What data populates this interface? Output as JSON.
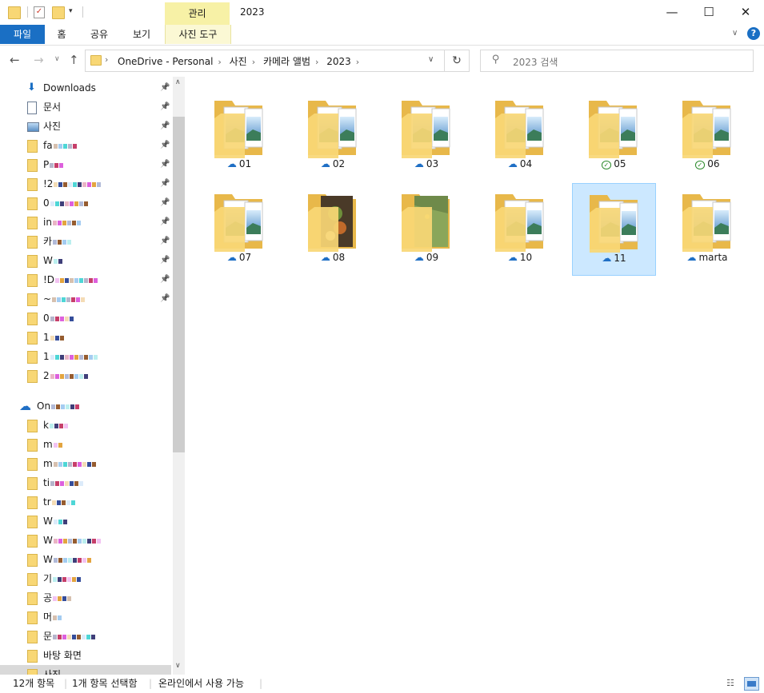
{
  "window": {
    "title": "2023",
    "contextual_group": "관리",
    "controls": {
      "minimize": "—",
      "maximize": "☐",
      "close": "✕"
    }
  },
  "ribbon": {
    "tabs": [
      "파일",
      "홈",
      "공유",
      "보기"
    ],
    "contextual_tab": "사진 도구"
  },
  "address": {
    "breadcrumbs": [
      "OneDrive - Personal",
      "사진",
      "카메라 앨범",
      "2023"
    ],
    "search_placeholder": "2023 검색"
  },
  "nav": {
    "items": [
      {
        "label": "Downloads",
        "icon": "download-icon",
        "pinned": true
      },
      {
        "label": "문서",
        "icon": "document-icon",
        "pinned": true
      },
      {
        "label": "사진",
        "icon": "picture-icon",
        "pinned": true
      },
      {
        "label": "fa",
        "icon": "folder-icon",
        "pinned": true
      },
      {
        "label": "P",
        "icon": "folder-icon",
        "pinned": true
      },
      {
        "label": "!2",
        "icon": "folder-icon",
        "pinned": true
      },
      {
        "label": "0",
        "icon": "folder-icon",
        "pinned": true
      },
      {
        "label": "in",
        "icon": "folder-icon",
        "pinned": true
      },
      {
        "label": "카",
        "icon": "folder-icon",
        "pinned": true
      },
      {
        "label": "W",
        "icon": "folder-icon",
        "pinned": true
      },
      {
        "label": "!D",
        "icon": "folder-icon",
        "pinned": true
      },
      {
        "label": "~",
        "icon": "folder-icon",
        "pinned": true
      },
      {
        "label": "0",
        "icon": "folder-icon",
        "pinned": false
      },
      {
        "label": "1",
        "icon": "folder-icon",
        "pinned": false
      },
      {
        "label": "1",
        "icon": "folder-icon",
        "pinned": false
      },
      {
        "label": "2",
        "icon": "folder-icon",
        "pinned": false
      },
      {
        "label": "On",
        "icon": "onedrive-cloud-icon",
        "pinned": false
      },
      {
        "label": "k",
        "icon": "folder-icon",
        "pinned": false
      },
      {
        "label": "m",
        "icon": "folder-icon",
        "pinned": false
      },
      {
        "label": "m",
        "icon": "folder-icon",
        "pinned": false
      },
      {
        "label": "ti",
        "icon": "folder-icon",
        "pinned": false
      },
      {
        "label": "tr",
        "icon": "folder-icon",
        "pinned": false
      },
      {
        "label": "W",
        "icon": "folder-icon",
        "pinned": false
      },
      {
        "label": "W",
        "icon": "folder-icon",
        "pinned": false
      },
      {
        "label": "W",
        "icon": "folder-icon",
        "pinned": false
      },
      {
        "label": "기",
        "icon": "folder-icon",
        "pinned": false
      },
      {
        "label": "공",
        "icon": "folder-icon",
        "pinned": false
      },
      {
        "label": "머",
        "icon": "folder-icon",
        "pinned": false
      },
      {
        "label": "문",
        "icon": "folder-icon",
        "pinned": false
      },
      {
        "label": "바탕 화면",
        "icon": "folder-icon",
        "pinned": false
      },
      {
        "label": "사진",
        "icon": "folder-icon",
        "pinned": false
      }
    ]
  },
  "files": [
    {
      "name": "01",
      "status": "cloud",
      "thumb": "landscape"
    },
    {
      "name": "02",
      "status": "cloud",
      "thumb": "landscape"
    },
    {
      "name": "03",
      "status": "cloud",
      "thumb": "landscape"
    },
    {
      "name": "04",
      "status": "cloud",
      "thumb": "landscape"
    },
    {
      "name": "05",
      "status": "synced",
      "thumb": "landscape"
    },
    {
      "name": "06",
      "status": "synced",
      "thumb": "landscape"
    },
    {
      "name": "07",
      "status": "cloud",
      "thumb": "landscape"
    },
    {
      "name": "08",
      "status": "cloud",
      "thumb": "food"
    },
    {
      "name": "09",
      "status": "cloud",
      "thumb": "grass"
    },
    {
      "name": "10",
      "status": "cloud",
      "thumb": "landscape"
    },
    {
      "name": "11",
      "status": "cloud",
      "thumb": "landscape",
      "selected": true
    },
    {
      "name": "marta",
      "status": "cloud",
      "thumb": "landscape"
    }
  ],
  "status": {
    "item_count": "12개 항목",
    "selection": "1개 항목 선택함",
    "availability": "온라인에서 사용 가능"
  },
  "colors": {
    "accent": "#1a6fc4",
    "selection_bg": "#cce8ff",
    "manage_tab": "#f7f1a6",
    "folder": "#f8d775",
    "cloud": "#1f6fc5",
    "synced": "#2b8a2b"
  }
}
